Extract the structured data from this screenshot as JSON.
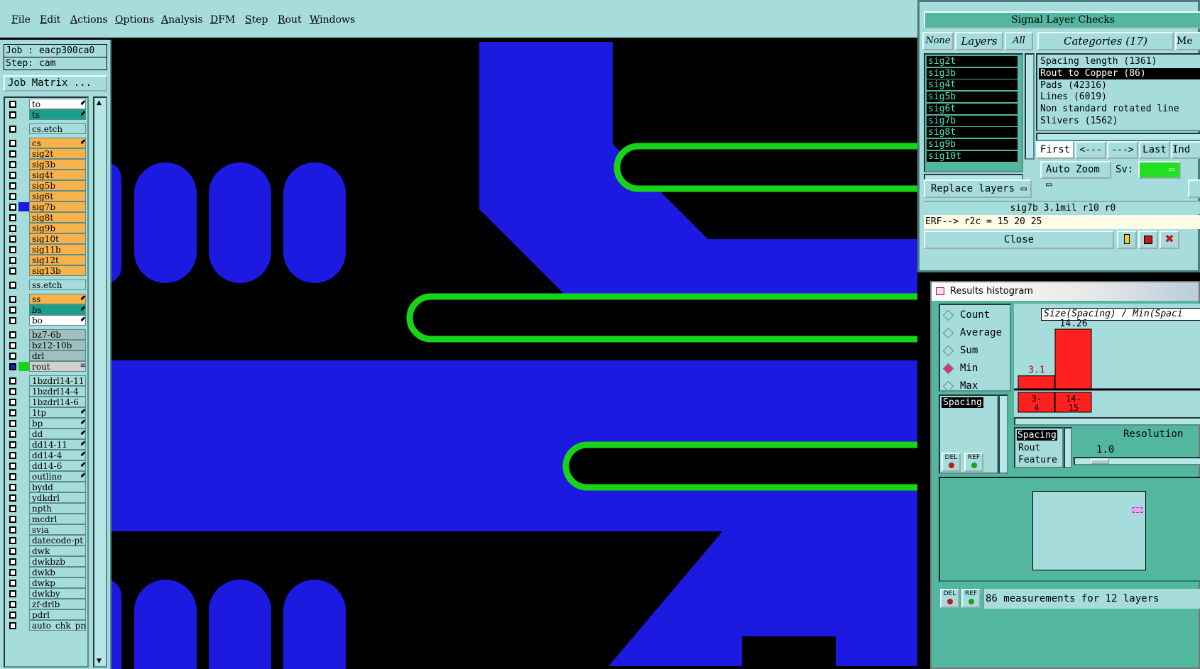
{
  "menubar": {
    "items": [
      "File",
      "Edit",
      "Actions",
      "Options",
      "Analysis",
      "DFM",
      "Step",
      "Rout",
      "Windows"
    ]
  },
  "job": {
    "job_label": "Job : eacp300ca0",
    "step_label": "Step: cam",
    "matrix_button": "Job Matrix ..."
  },
  "layers": [
    {
      "name": "to",
      "color": "#ffffff",
      "arrow": "⬋"
    },
    {
      "name": "ts",
      "color": "#19a08a",
      "arrow": "⬋"
    },
    {
      "name": "cs.etch",
      "color": "#a6dcdc",
      "arrow": ""
    },
    {
      "name": "cs",
      "color": "#f8b24c",
      "arrow": "⬋"
    },
    {
      "name": "sig2t",
      "color": "#f8b24c",
      "arrow": ""
    },
    {
      "name": "sig3b",
      "color": "#f8b24c",
      "arrow": ""
    },
    {
      "name": "sig4t",
      "color": "#f8b24c",
      "arrow": ""
    },
    {
      "name": "sig5b",
      "color": "#f8b24c",
      "arrow": ""
    },
    {
      "name": "sig6t",
      "color": "#f8b24c",
      "arrow": ""
    },
    {
      "name": "sig7b",
      "color": "#f8b24c",
      "arrow": ""
    },
    {
      "name": "sig8t",
      "color": "#f8b24c",
      "arrow": ""
    },
    {
      "name": "sig9b",
      "color": "#f8b24c",
      "arrow": ""
    },
    {
      "name": "sig10t",
      "color": "#f8b24c",
      "arrow": ""
    },
    {
      "name": "sig11b",
      "color": "#f8b24c",
      "arrow": ""
    },
    {
      "name": "sig12t",
      "color": "#f8b24c",
      "arrow": ""
    },
    {
      "name": "sig13b",
      "color": "#f8b24c",
      "arrow": ""
    },
    {
      "name": "ss.etch",
      "color": "#a6dcdc",
      "arrow": ""
    },
    {
      "name": "ss",
      "color": "#f8b24c",
      "arrow": "⬋"
    },
    {
      "name": "bs",
      "color": "#19a08a",
      "arrow": "⬋"
    },
    {
      "name": "bo",
      "color": "#ffffff",
      "arrow": "⬋"
    },
    {
      "name": "bz7-6b",
      "color": "#a0c0c0",
      "arrow": ""
    },
    {
      "name": "bz12-10b",
      "color": "#a0c0c0",
      "arrow": ""
    },
    {
      "name": "drl",
      "color": "#a0c0c0",
      "arrow": ""
    },
    {
      "name": "rout",
      "color": "#d0d0d0",
      "arrow": "≡"
    },
    {
      "name": "1bzdrl14-11",
      "color": "#a6dcdc",
      "arrow": ""
    },
    {
      "name": "1bzdrl14-4",
      "color": "#a6dcdc",
      "arrow": ""
    },
    {
      "name": "1bzdrl14-6",
      "color": "#a6dcdc",
      "arrow": ""
    },
    {
      "name": "1tp",
      "color": "#a6dcdc",
      "arrow": "⬋"
    },
    {
      "name": "bp",
      "color": "#a6dcdc",
      "arrow": "⬋"
    },
    {
      "name": "dd",
      "color": "#a6dcdc",
      "arrow": "⬋"
    },
    {
      "name": "dd14-11",
      "color": "#a6dcdc",
      "arrow": "⬋"
    },
    {
      "name": "dd14-4",
      "color": "#a6dcdc",
      "arrow": "⬋"
    },
    {
      "name": "dd14-6",
      "color": "#a6dcdc",
      "arrow": "⬋"
    },
    {
      "name": "outline",
      "color": "#a6dcdc",
      "arrow": "⬋"
    },
    {
      "name": "bydd",
      "color": "#a6dcdc",
      "arrow": ""
    },
    {
      "name": "ydkdrl",
      "color": "#a6dcdc",
      "arrow": ""
    },
    {
      "name": "npth",
      "color": "#a6dcdc",
      "arrow": ""
    },
    {
      "name": "mcdrl",
      "color": "#a6dcdc",
      "arrow": ""
    },
    {
      "name": "svia",
      "color": "#a6dcdc",
      "arrow": ""
    },
    {
      "name": "datecode-pt",
      "color": "#a6dcdc",
      "arrow": ""
    },
    {
      "name": "dwk",
      "color": "#a6dcdc",
      "arrow": ""
    },
    {
      "name": "dwkbzb",
      "color": "#a6dcdc",
      "arrow": ""
    },
    {
      "name": "dwkb",
      "color": "#a6dcdc",
      "arrow": ""
    },
    {
      "name": "dwkp",
      "color": "#a6dcdc",
      "arrow": ""
    },
    {
      "name": "dwkby",
      "color": "#a6dcdc",
      "arrow": ""
    },
    {
      "name": "zf-drlb",
      "color": "#a6dcdc",
      "arrow": ""
    },
    {
      "name": "pdrl",
      "color": "#a6dcdc",
      "arrow": ""
    },
    {
      "name": "auto_chk_pn",
      "color": "#a6dcdc",
      "arrow": ""
    }
  ],
  "signal_checks": {
    "title": "Signal Layer Checks",
    "none_btn": "None",
    "layers_btn": "Layers",
    "all_btn": "All",
    "categories_btn": "Categories (17)",
    "me_btn": "Me",
    "layer_items": [
      "sig2t",
      "sig3b",
      "sig4t",
      "sig5b",
      "sig6t",
      "sig7b",
      "sig8t",
      "sig9b",
      "sig10t"
    ],
    "categories": [
      "Spacing length (1361)",
      "Rout to Copper (86)",
      "Pads (42316)",
      "Lines (6019)",
      "Non standard rotated line",
      "Slivers (1562)"
    ],
    "nav": {
      "first": "First",
      "prev": "<---",
      "next": "--->",
      "last": "Last",
      "ind": "Ind"
    },
    "auto_zoom": "Auto Zoom",
    "sv_label": "Sv:",
    "replace_layers": "Replace layers",
    "status": "sig7b  3.1mil  r10   r0",
    "erf": "ERF--> r2c = 15 20 25",
    "close": "Close"
  },
  "histogram": {
    "title": "Results histogram",
    "modes": [
      "Count",
      "Average",
      "Sum",
      "Min",
      "Max"
    ],
    "selected_mode": "Min",
    "measure_list": [
      "Spacing"
    ],
    "chart_title": "Size(Spacing) / Min(Spaci",
    "bins": [
      {
        "label1": "3-",
        "label2": "4",
        "value": 3.1,
        "value_label": "3.1"
      },
      {
        "label1": "14-",
        "label2": "15",
        "value": 14.26,
        "value_label": "14.26"
      }
    ],
    "types": [
      "Spacing",
      "Rout",
      "Feature"
    ],
    "resolution_label": "Resolution",
    "resolution_value": "1.0",
    "del": "DEL",
    "ref": "REF",
    "footer": "86 measurements for 12 layers"
  },
  "colors": {
    "board_bg": "#000000",
    "copper": "#1c1ae0",
    "rout": "#18d418",
    "panel": "#a6dcdc",
    "accent_green": "#53b7a0",
    "bar": "#ff2020"
  }
}
